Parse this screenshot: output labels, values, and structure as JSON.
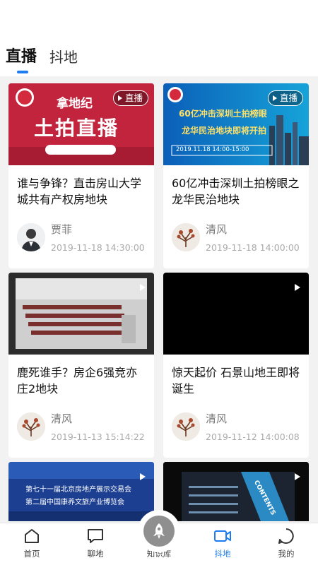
{
  "tabs": [
    {
      "label": "直播",
      "active": true
    },
    {
      "label": "抖地",
      "active": false
    }
  ],
  "live_badge_label": "直播",
  "cards": [
    {
      "title": "谁与争锋？直击房山大学城共有产权房地块",
      "author": "贾菲",
      "time": "2019-11-18 14:30:00",
      "badge": "live",
      "thumb_text": {
        "top": "拿地纪",
        "main": "土拍直播"
      }
    },
    {
      "title": "60亿冲击深圳土拍榜眼之龙华民治地块",
      "author": "清风",
      "time": "2019-11-18 14:00:00",
      "badge": "live",
      "thumb_text": {
        "line1": "60亿冲击深圳土拍榜眼",
        "line2": "龙华民治地块即将开拍",
        "date": "2019.11.18 14:00-15:00"
      }
    },
    {
      "title": "鹿死谁手？房企6强竞亦庄2地块",
      "author": "清风",
      "time": "2019-11-13 15:14:22",
      "badge": "video"
    },
    {
      "title": "惊天起价 石景山地王即将诞生",
      "author": "清风",
      "time": "2019-11-12 14:00:08",
      "badge": "video"
    },
    {
      "badge": "video",
      "thumb_text": {
        "line1": "第七十一届北京房地产展示交易会",
        "line2": "第二届中国康养文旅产业博览会"
      }
    },
    {
      "badge": "video",
      "thumb_text": {
        "line1": "CONTENTS"
      }
    }
  ],
  "bottom_nav": [
    {
      "label": "首页",
      "icon": "home-icon",
      "active": false
    },
    {
      "label": "聊地",
      "icon": "chat-icon",
      "active": false
    },
    {
      "label": "知识库",
      "icon": "knowledge-icon",
      "active": false
    },
    {
      "label": "抖地",
      "icon": "video-icon",
      "active": true
    },
    {
      "label": "我的",
      "icon": "profile-icon",
      "active": false
    }
  ],
  "colors": {
    "accent": "#1e7cf2",
    "live_red": "#c2243d",
    "background": "#f2f2f2"
  }
}
